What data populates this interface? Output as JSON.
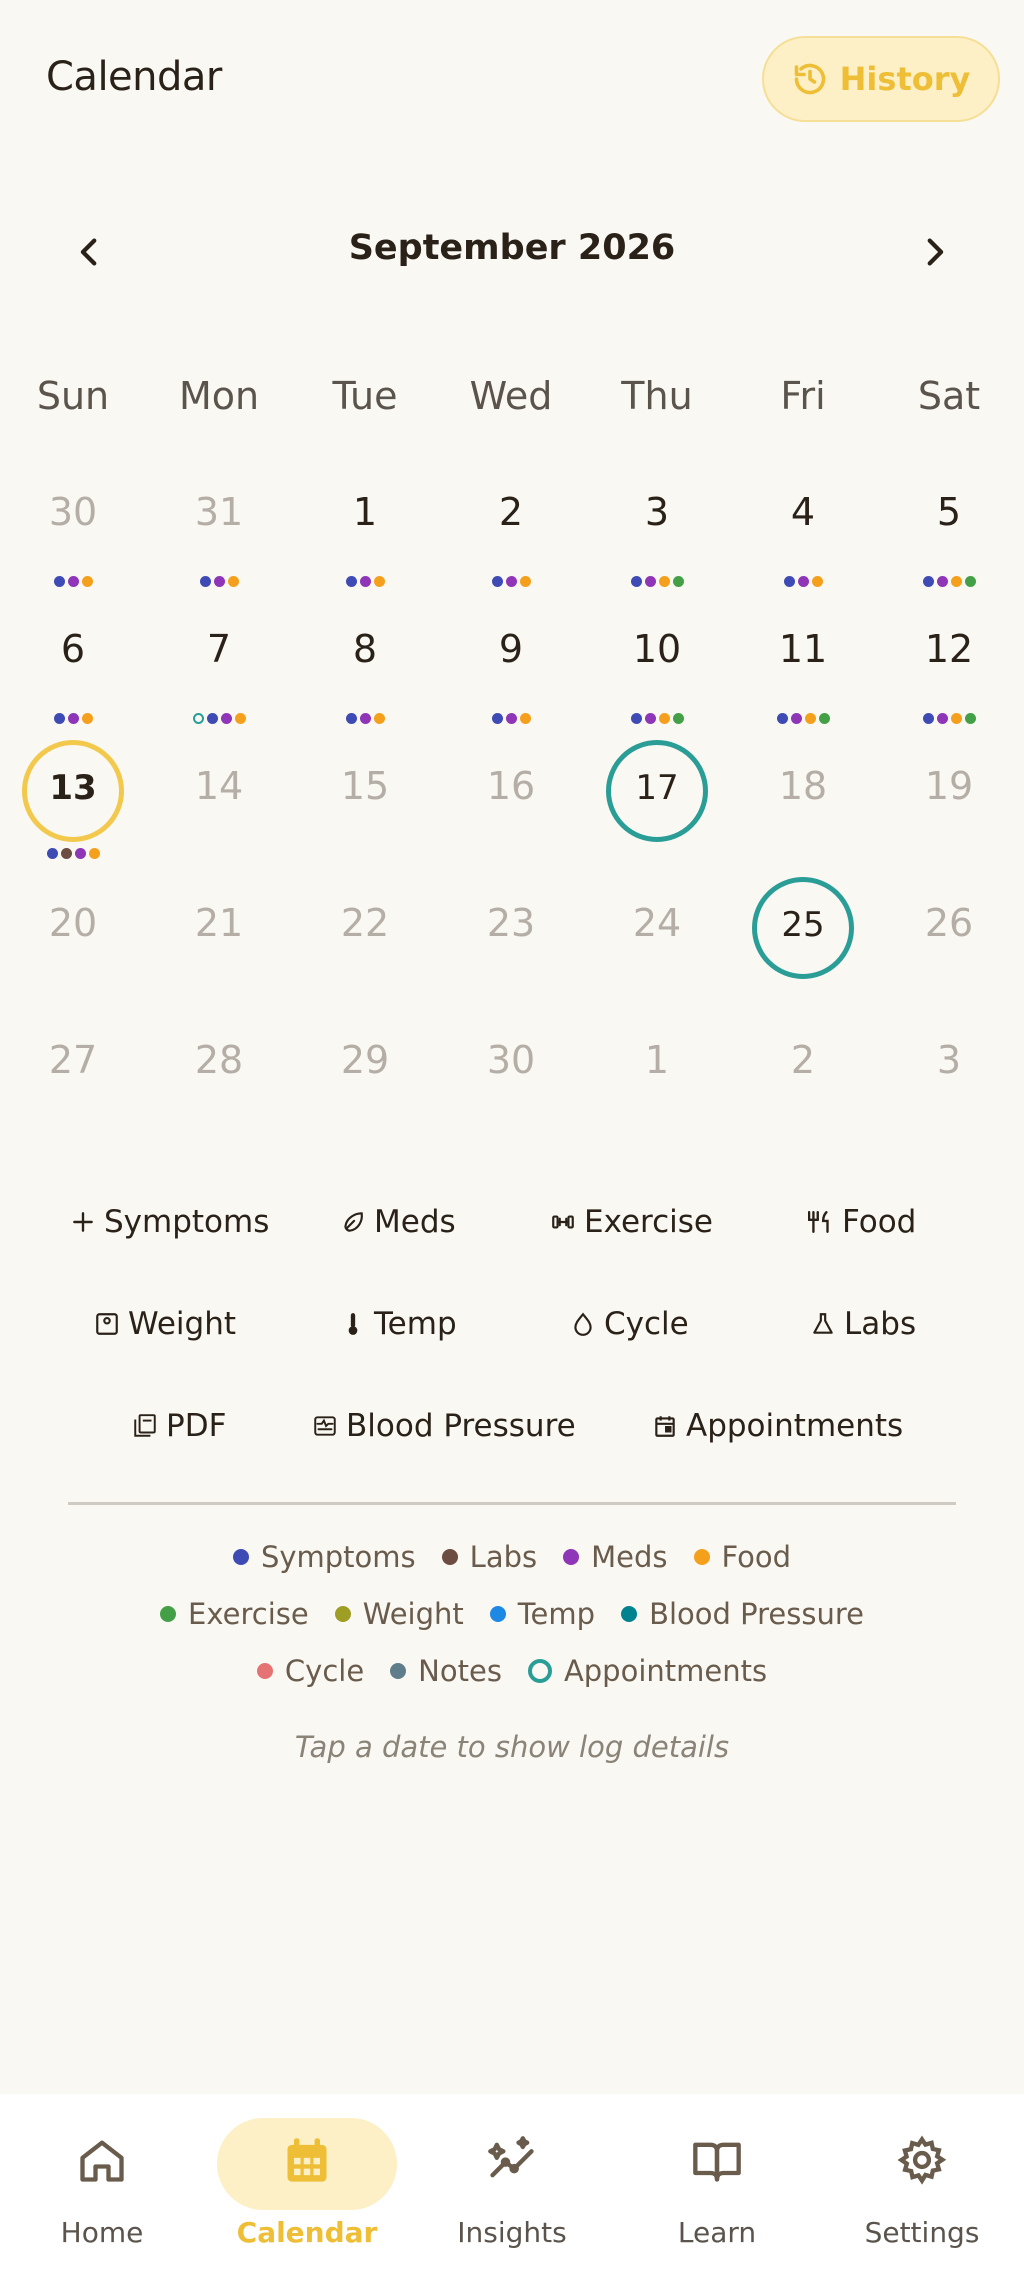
{
  "header": {
    "title": "Calendar",
    "history_label": "History"
  },
  "calendar": {
    "month_label": "September 2026",
    "weekdays": [
      "Sun",
      "Mon",
      "Tue",
      "Wed",
      "Thu",
      "Fri",
      "Sat"
    ],
    "weeks": [
      [
        {
          "day": "30",
          "muted": true,
          "dots": [
            "#3f4bb5",
            "#8e35b8",
            "#f5a01d"
          ]
        },
        {
          "day": "31",
          "muted": true,
          "dots": [
            "#3f4bb5",
            "#8e35b8",
            "#f5a01d"
          ]
        },
        {
          "day": "1",
          "muted": false,
          "dots": [
            "#3f4bb5",
            "#8e35b8",
            "#f5a01d"
          ]
        },
        {
          "day": "2",
          "muted": false,
          "dots": [
            "#3f4bb5",
            "#8e35b8",
            "#f5a01d"
          ]
        },
        {
          "day": "3",
          "muted": false,
          "dots": [
            "#3f4bb5",
            "#8e35b8",
            "#f5a01d",
            "#43a047"
          ]
        },
        {
          "day": "4",
          "muted": false,
          "dots": [
            "#3f4bb5",
            "#8e35b8",
            "#f5a01d"
          ]
        },
        {
          "day": "5",
          "muted": false,
          "dots": [
            "#3f4bb5",
            "#8e35b8",
            "#f5a01d",
            "#43a047"
          ]
        }
      ],
      [
        {
          "day": "6",
          "muted": false,
          "dots": [
            "#3f4bb5",
            "#8e35b8",
            "#f5a01d"
          ]
        },
        {
          "day": "7",
          "muted": false,
          "dots": [
            "ring",
            "#3f4bb5",
            "#8e35b8",
            "#f5a01d"
          ]
        },
        {
          "day": "8",
          "muted": false,
          "dots": [
            "#3f4bb5",
            "#8e35b8",
            "#f5a01d"
          ]
        },
        {
          "day": "9",
          "muted": false,
          "dots": [
            "#3f4bb5",
            "#8e35b8",
            "#f5a01d"
          ]
        },
        {
          "day": "10",
          "muted": false,
          "dots": [
            "#3f4bb5",
            "#8e35b8",
            "#f5a01d",
            "#43a047"
          ]
        },
        {
          "day": "11",
          "muted": false,
          "dots": [
            "#3f4bb5",
            "#8e35b8",
            "#f5a01d",
            "#43a047"
          ]
        },
        {
          "day": "12",
          "muted": false,
          "dots": [
            "#3f4bb5",
            "#8e35b8",
            "#f5a01d",
            "#43a047"
          ]
        }
      ],
      [
        {
          "day": "13",
          "muted": false,
          "today": true,
          "dots": [
            "#3f4bb5",
            "#6d4c41",
            "#8e35b8",
            "#f5a01d"
          ]
        },
        {
          "day": "14",
          "muted": true,
          "dots": []
        },
        {
          "day": "15",
          "muted": true,
          "dots": []
        },
        {
          "day": "16",
          "muted": true,
          "dots": []
        },
        {
          "day": "17",
          "muted": false,
          "appointment": true,
          "dots": []
        },
        {
          "day": "18",
          "muted": true,
          "dots": []
        },
        {
          "day": "19",
          "muted": true,
          "dots": []
        }
      ],
      [
        {
          "day": "20",
          "muted": true,
          "dots": []
        },
        {
          "day": "21",
          "muted": true,
          "dots": []
        },
        {
          "day": "22",
          "muted": true,
          "dots": []
        },
        {
          "day": "23",
          "muted": true,
          "dots": []
        },
        {
          "day": "24",
          "muted": true,
          "dots": []
        },
        {
          "day": "25",
          "muted": false,
          "appointment": true,
          "dots": []
        },
        {
          "day": "26",
          "muted": true,
          "dots": []
        }
      ],
      [
        {
          "day": "27",
          "muted": true,
          "dots": []
        },
        {
          "day": "28",
          "muted": true,
          "dots": []
        },
        {
          "day": "29",
          "muted": true,
          "dots": []
        },
        {
          "day": "30",
          "muted": true,
          "dots": []
        },
        {
          "day": "1",
          "muted": true,
          "dots": []
        },
        {
          "day": "2",
          "muted": true,
          "dots": []
        },
        {
          "day": "3",
          "muted": true,
          "dots": []
        }
      ]
    ]
  },
  "quick_actions": {
    "symptoms": "Symptoms",
    "meds": "Meds",
    "exercise": "Exercise",
    "food": "Food",
    "weight": "Weight",
    "temp": "Temp",
    "cycle": "Cycle",
    "labs": "Labs",
    "pdf": "PDF",
    "blood_pressure": "Blood Pressure",
    "appointments": "Appointments"
  },
  "legend": {
    "symptoms": {
      "label": "Symptoms",
      "color": "#3f4bb5"
    },
    "labs": {
      "label": "Labs",
      "color": "#6d4c41"
    },
    "meds": {
      "label": "Meds",
      "color": "#8e35b8"
    },
    "food": {
      "label": "Food",
      "color": "#f5a01d"
    },
    "exercise": {
      "label": "Exercise",
      "color": "#43a047"
    },
    "weight": {
      "label": "Weight",
      "color": "#9e9d24"
    },
    "temp": {
      "label": "Temp",
      "color": "#1e88e5"
    },
    "blood_pressure": {
      "label": "Blood Pressure",
      "color": "#00838f"
    },
    "cycle": {
      "label": "Cycle",
      "color": "#e57373"
    },
    "notes": {
      "label": "Notes",
      "color": "#607d8b"
    },
    "appointments": {
      "label": "Appointments",
      "color": "#2a9d96"
    }
  },
  "hint": "Tap a date to show log details",
  "bottom_nav": {
    "home": "Home",
    "calendar": "Calendar",
    "insights": "Insights",
    "learn": "Learn",
    "settings": "Settings"
  },
  "colors": {
    "accent": "#eebe36",
    "appointment_ring": "#2a9d96",
    "today_ring": "#f2c94c"
  }
}
